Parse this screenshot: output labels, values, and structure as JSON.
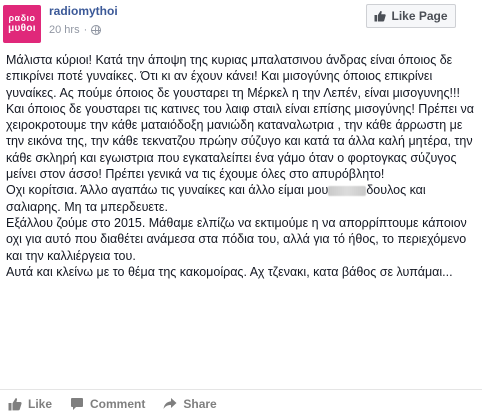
{
  "page": {
    "avatar_line1": "ραδιο",
    "avatar_line2": "μυθοι",
    "name": "radiomythoi",
    "time": "20 hrs",
    "separator": "·"
  },
  "like_page_button": {
    "label": "Like Page",
    "icon": "thumbs-up-icon"
  },
  "post": {
    "paragraph1": "Μάλιστα κύριοι! Κατά την άποψη της κυριας μπαλατσινου άνδρας είναι όποιος δε επικρίνει ποτέ γυναίκες. Ότι κι αν έχουν κάνει! Και μισογύνης όποιος επικρίνει γυναίκες. Ας πούμε όποιος δε γουσταρει τη Μέρκελ η την Λεπέν, είναι μισογυνης!!! Και όποιος δε γουσταρει τις κατινες του λαιφ σταιλ είναι επίσης μισογύνης! Πρέπει να χειροκροτουμε την κάθε ματαιόδοξη μανιώδη καταναλωτρια , την κάθε άρρωστη με την εικόνα της, την κάθε τεκνατζου πρώην σύζυγο και κατά τα άλλα καλή μητέρα, την κάθε σκληρή και εγωιστρια που εγκαταλείπει ένα γάμο όταν ο φορτογκας σύζυγος μείνει στον άσσο! Πρέπει γενικά να τις έχουμε όλες στο απυρόβλητο!",
    "paragraph2_start": "Οχι κορίτσια. Άλλο αγαπάω τις γυναίκες και άλλο είμαι μου",
    "paragraph2_end": "δουλος και σαλιαρης. Μη τα μπερδευετε.",
    "paragraph3": "Εξάλλου ζούμε στο 2015. Μάθαμε ελπίζω να εκτιμούμε η να απορρίπτουμε κάποιον οχι για αυτό που διαθέτει ανάμεσα στα πόδια του, αλλά για τό ήθος, το περιεχόμενο και την καλλιέργεια του.",
    "paragraph4": "Αυτά και κλείνω με το θέμα της κακομοίρας. Αχ τζενακι, κατα βάθος σε λυπάμαι..."
  },
  "actions": [
    {
      "label": "Like",
      "icon": "like-icon"
    },
    {
      "label": "Comment",
      "icon": "comment-icon"
    },
    {
      "label": "Share",
      "icon": "share-icon"
    }
  ],
  "colors": {
    "brand_pink": "#e0287a",
    "link_blue": "#3b5998",
    "muted_gray": "#9197a3",
    "action_gray": "#7f7f7f"
  }
}
